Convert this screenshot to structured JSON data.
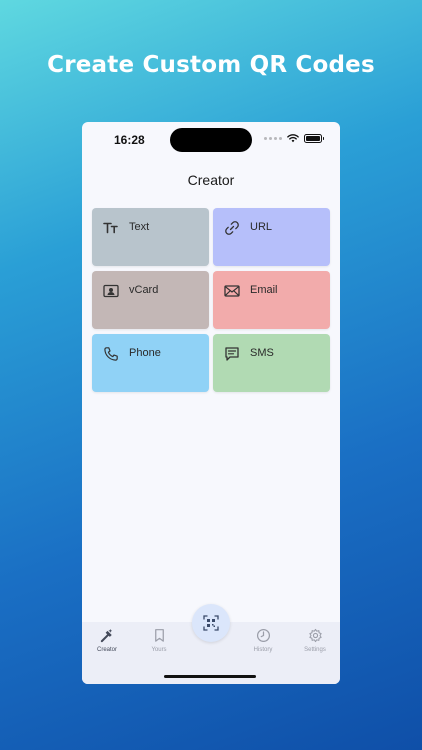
{
  "headline": "Create Custom QR Codes",
  "status_bar": {
    "time": "16:28"
  },
  "nav": {
    "title": "Creator"
  },
  "tiles": [
    {
      "label": "Text",
      "icon": "text-format-icon",
      "color": "#b8c4cc"
    },
    {
      "label": "URL",
      "icon": "link-icon",
      "color": "#b6bffa"
    },
    {
      "label": "vCard",
      "icon": "contact-card-icon",
      "color": "#c3b7b6"
    },
    {
      "label": "Email",
      "icon": "envelope-icon",
      "color": "#f2abab"
    },
    {
      "label": "Phone",
      "icon": "phone-icon",
      "color": "#90d2f6"
    },
    {
      "label": "SMS",
      "icon": "chat-bubble-icon",
      "color": "#b1dab3"
    }
  ],
  "tabbar": {
    "creator_label": "Creator",
    "yours_label": "Yours",
    "history_label": "History",
    "settings_label": "Settings",
    "active": "Creator"
  },
  "colors": {
    "phone_bg": "#f7f8fd",
    "tabbar_bg": "#eceef7",
    "fab_bg": "#dbe6fb"
  }
}
